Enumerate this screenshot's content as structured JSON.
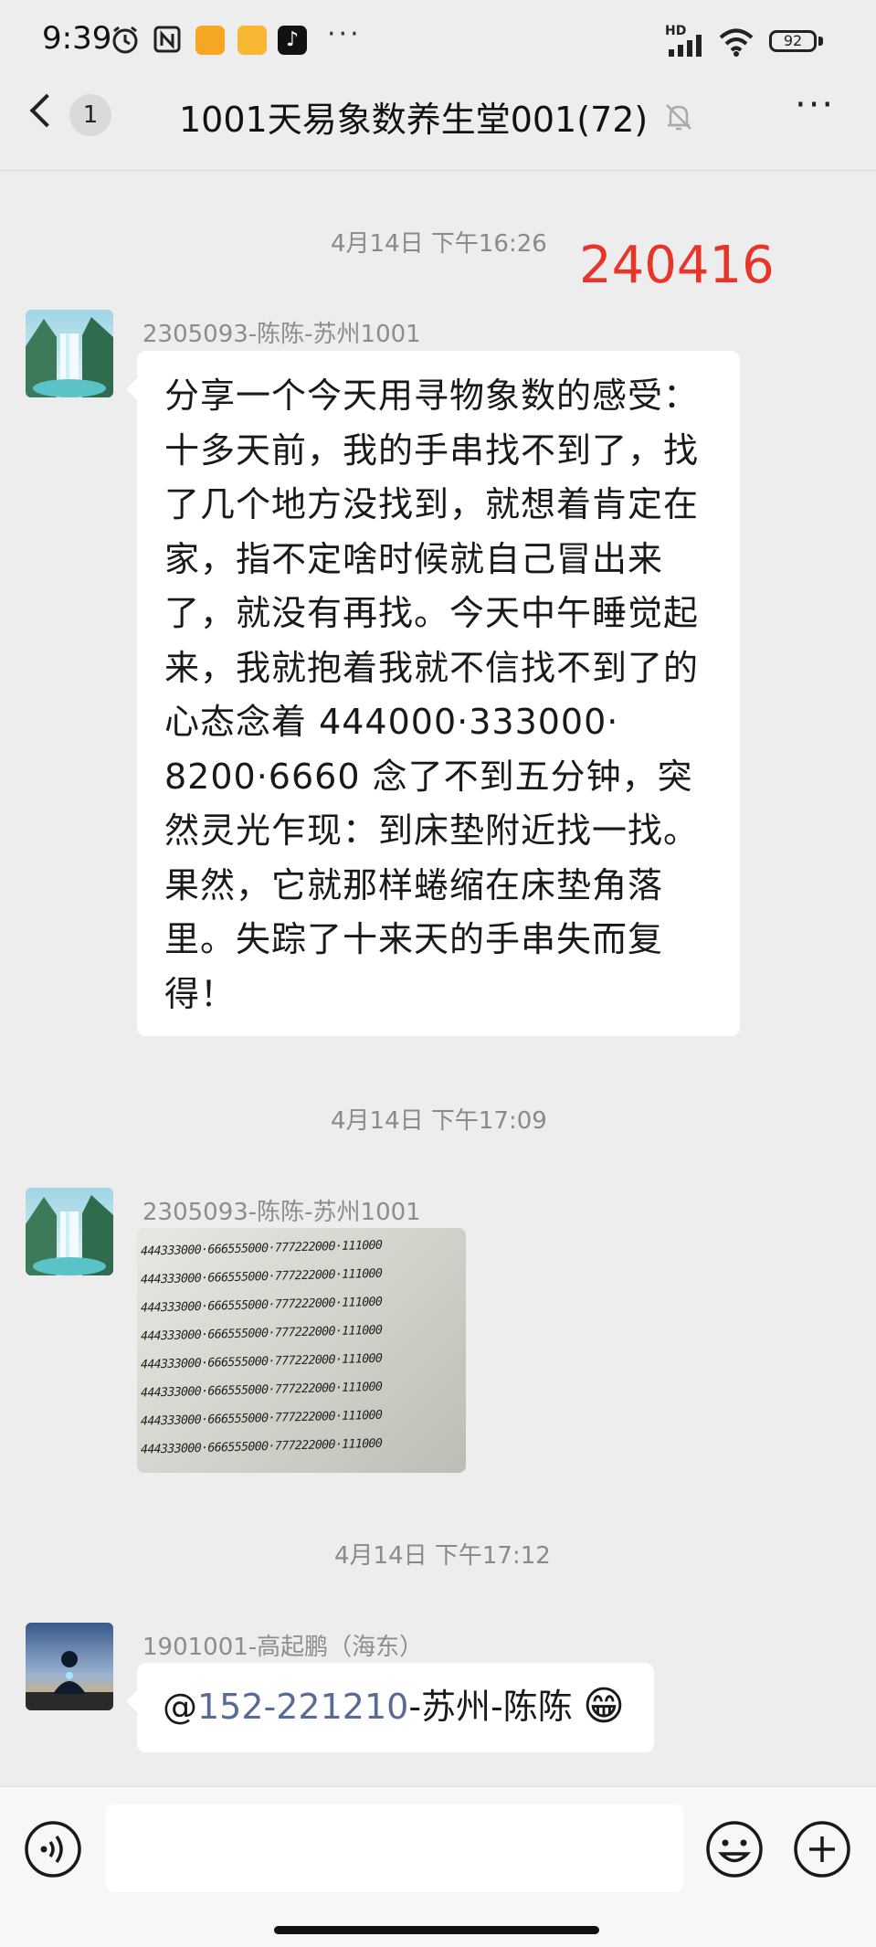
{
  "status_bar": {
    "time": "9:39",
    "network": "HD",
    "battery": "92",
    "more": "···"
  },
  "header": {
    "back_badge": "1",
    "title": "1001天易象数养生堂001(72)",
    "menu": "···"
  },
  "annotation": "240416",
  "messages": [
    {
      "timestamp": "4月14日 下午16:26",
      "sender": "2305093-陈陈-苏州1001",
      "lines": [
        "分享一个今天用寻物象数的感受：",
        "十多天前，我的手串找不到了，找",
        "了几个地方没找到，就想着肯定在",
        "家，指不定啥时候就自己冒出来",
        "了，就没有再找。今天中午睡觉起",
        "来，我就抱着我就不信找不到了的",
        "心态念着 444000·333000·",
        "8200·6660 念了不到五分钟，突",
        "然灵光乍现：到床垫附近找一找。",
        "果然，它就那样蜷缩在床垫角落",
        "里。失踪了十来天的手串失而复",
        "得！"
      ]
    },
    {
      "timestamp": "4月14日 下午17:09",
      "sender": "2305093-陈陈-苏州1001",
      "photo_lines": [
        "444333000·666555000·777222000·111000",
        "444333000·666555000·777222000·111000",
        "444333000·666555000·777222000·111000",
        "444333000·666555000·777222000·111000",
        "444333000·666555000·777222000·111000",
        "444333000·666555000·777222000·111000",
        "444333000·666555000·777222000·111000",
        "444333000·666555000·777222000·111000"
      ]
    },
    {
      "timestamp": "4月14日 下午17:12",
      "sender": "1901001-高起鹏（海东）",
      "mention_prefix": "@",
      "mention": "152-221210",
      "mention_rest": "-苏州-陈陈",
      "emoji": "😁"
    }
  ],
  "colors": {
    "annotation": "#e8352a",
    "mention": "#576b95",
    "background": "#ededed",
    "bubble": "#ffffff"
  }
}
